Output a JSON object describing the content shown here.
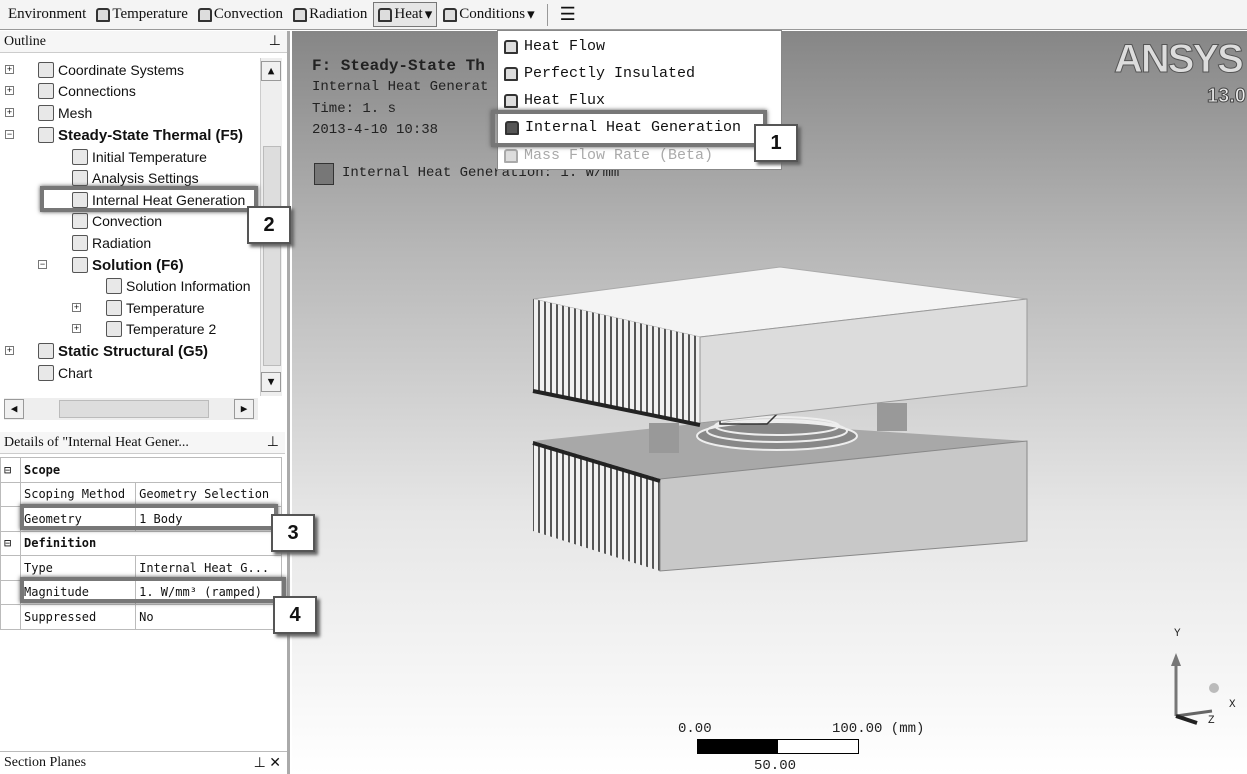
{
  "toolbar": {
    "items": [
      {
        "label": "Environment"
      },
      {
        "label": "Temperature"
      },
      {
        "label": "Convection"
      },
      {
        "label": "Radiation"
      },
      {
        "label": "Heat",
        "dropdown": true,
        "active": true
      },
      {
        "label": "Conditions",
        "dropdown": true
      }
    ]
  },
  "heat_menu": {
    "items": [
      {
        "label": "Heat Flow"
      },
      {
        "label": "Perfectly Insulated"
      },
      {
        "label": "Heat Flux"
      },
      {
        "label": "Internal Heat Generation",
        "highlighted": true
      },
      {
        "label": "Mass Flow Rate (Beta)",
        "disabled": true
      }
    ]
  },
  "outline": {
    "title": "Outline",
    "nodes": [
      {
        "label": "Coordinate Systems"
      },
      {
        "label": "Connections"
      },
      {
        "label": "Mesh"
      },
      {
        "label": "Steady-State Thermal (F5)"
      },
      {
        "label": "Initial Temperature"
      },
      {
        "label": "Analysis Settings"
      },
      {
        "label": "Internal Heat Generation",
        "selected": true
      },
      {
        "label": "Convection"
      },
      {
        "label": "Radiation"
      },
      {
        "label": "Solution (F6)"
      },
      {
        "label": "Solution Information"
      },
      {
        "label": "Temperature"
      },
      {
        "label": "Temperature 2"
      },
      {
        "label": "Static Structural (G5)"
      },
      {
        "label": "Chart"
      }
    ]
  },
  "details": {
    "title": "Details of \"Internal Heat Gener...",
    "groups": [
      {
        "label": "Scope",
        "rows": [
          {
            "key": "Scoping Method",
            "value": "Geometry Selection"
          },
          {
            "key": "Geometry",
            "value": "1 Body"
          }
        ]
      },
      {
        "label": "Definition",
        "rows": [
          {
            "key": "Type",
            "value": "Internal Heat G..."
          },
          {
            "key": "Magnitude",
            "value": "1. W/mm³  (ramped)"
          },
          {
            "key": "Suppressed",
            "value": "No"
          }
        ]
      }
    ]
  },
  "section_planes": {
    "title": "Section Planes"
  },
  "viewport": {
    "title": "F: Steady-State Th",
    "subtitle": "Internal Heat Generat",
    "time": "Time: 1. s",
    "date": "2013-4-10 10:38",
    "legend": "Internal Heat Generation: 1. W/mm",
    "logo": "ANSYS",
    "version": "13.0",
    "scale": {
      "left": "0.00",
      "right": "100.00 (mm)",
      "mid": "50.00"
    },
    "axes": {
      "y": "Y",
      "x": "X",
      "z": "Z"
    }
  },
  "callouts": [
    "1",
    "2",
    "3",
    "4"
  ],
  "colors": {
    "viewport_top": "#868686",
    "viewport_bottom": "#ffffff",
    "highlight": "#777777"
  }
}
